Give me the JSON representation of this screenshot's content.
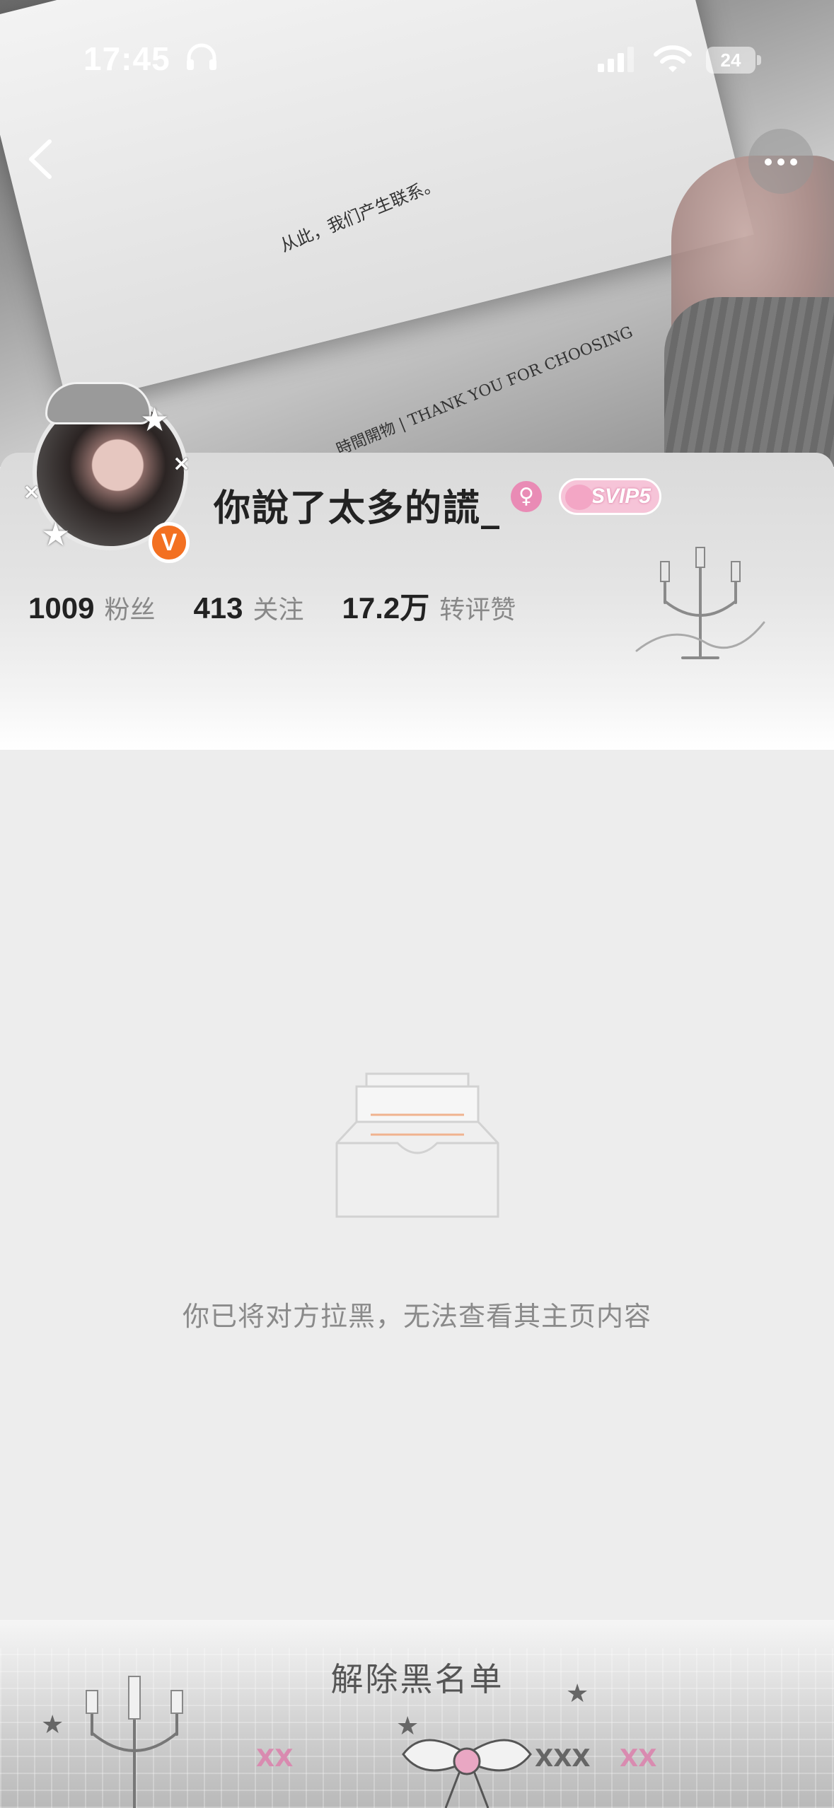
{
  "status_bar": {
    "time": "17:45",
    "battery": "24",
    "icons": [
      "headphones-icon",
      "cellular-signal-icon",
      "wifi-icon",
      "battery-icon"
    ]
  },
  "cover": {
    "card_text": "从此，我们产生联系。",
    "card_brand": "時間開物 | THANK YOU FOR CHOOSING"
  },
  "nav": {
    "back_icon": "chevron-left-icon",
    "more_icon": "more-horizontal-icon"
  },
  "profile": {
    "nickname": "你說了太多的謊_",
    "gender_icon": "female-icon",
    "gender_symbol": "♀",
    "svip_label": "SVIP5",
    "verified_label": "V",
    "verified_color": "#f37021",
    "stats": [
      {
        "value": "1009",
        "label": "粉丝"
      },
      {
        "value": "413",
        "label": "关注"
      },
      {
        "value": "17.2万",
        "label": "转评赞"
      }
    ]
  },
  "empty_state": {
    "icon": "empty-inbox-icon",
    "message": "你已将对方拉黑，无法查看其主页内容"
  },
  "bottom_bar": {
    "unblock_label": "解除黑名单",
    "deco_x_1": "XX",
    "deco_x_2": "XXX",
    "deco_x_3": "XX"
  }
}
